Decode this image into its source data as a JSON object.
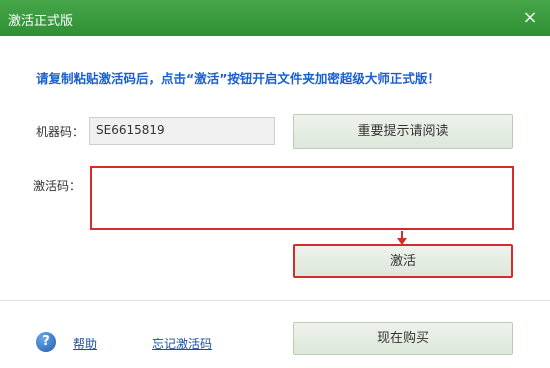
{
  "window": {
    "title": "激活正式版",
    "close_glyph": "×"
  },
  "instruction": "请复制粘贴激活码后，点击“激活”按钮开启文件夹加密超级大师正式版！",
  "machine": {
    "label": "机器码：",
    "value": "SE6615819"
  },
  "activation": {
    "label": "激活码：",
    "value": "",
    "placeholder": ""
  },
  "buttons": {
    "notice": "重要提示请阅读",
    "activate": "激活",
    "buy": "现在购买"
  },
  "footer": {
    "help_icon_glyph": "?",
    "help": "帮助",
    "forgot": "忘记激活码"
  },
  "colors": {
    "titlebar": "#3d9b40",
    "instruction": "#1a5fd0",
    "highlight": "#d42b2b",
    "link": "#1a4fa0"
  },
  "icons": {
    "close": "close-icon",
    "help": "help-icon",
    "arrow": "arrow-down-icon"
  }
}
